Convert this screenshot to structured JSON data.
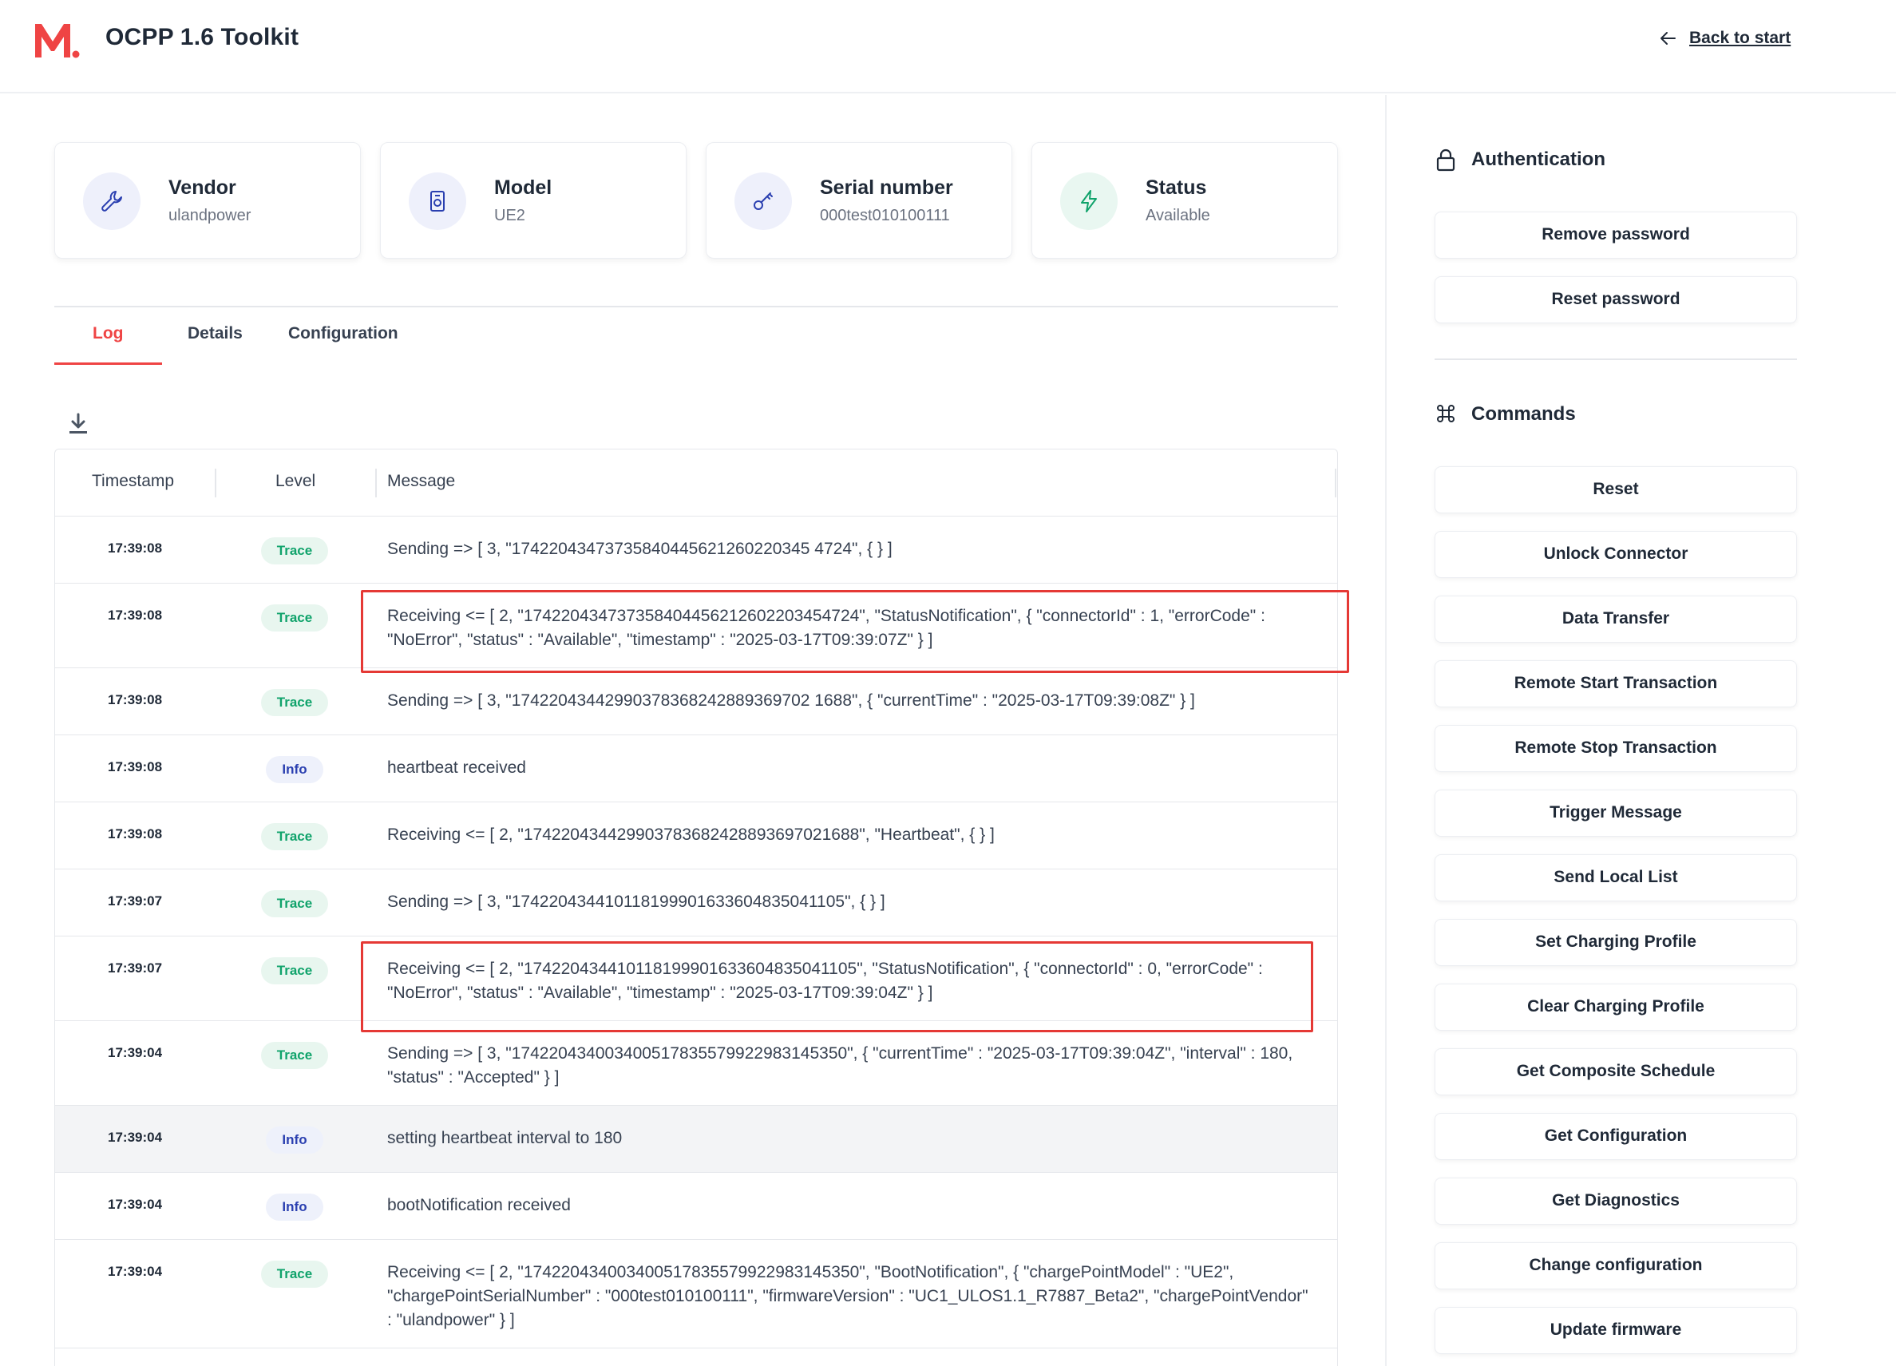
{
  "header": {
    "app_title": "OCPP 1.6 Toolkit",
    "back_label": "Back to start",
    "logo_icon": "m-logo-icon",
    "brand_color": "#ef4444"
  },
  "cards": [
    {
      "title": "Vendor",
      "value": "ulandpower",
      "icon": "wrench-icon"
    },
    {
      "title": "Model",
      "value": "UE2",
      "icon": "charger-icon"
    },
    {
      "title": "Serial number",
      "value": "000test010100111",
      "icon": "key-icon"
    },
    {
      "title": "Status",
      "value": "Available",
      "icon": "bolt-icon"
    }
  ],
  "tabs": [
    {
      "label": "Log",
      "active": true
    },
    {
      "label": "Details",
      "active": false
    },
    {
      "label": "Configuration",
      "active": false
    }
  ],
  "log_table": {
    "columns": [
      "Timestamp",
      "Level",
      "Message"
    ],
    "rows": [
      {
        "time": "17:39:08",
        "level": "Trace",
        "message": "Sending => [ 3, \"17422043473735840445621260220345 4724\", { } ]"
      },
      {
        "time": "17:39:08",
        "level": "Trace",
        "message": "Receiving <= [ 2, \"174220434737358404456212602203454724\", \"StatusNotification\", { \"connectorId\" : 1, \"errorCode\" : \"NoError\", \"status\" : \"Available\", \"timestamp\" : \"2025-03-17T09:39:07Z\" } ]"
      },
      {
        "time": "17:39:08",
        "level": "Trace",
        "message": "Sending => [ 3, \"17422043442990378368242889369702 1688\", { \"currentTime\" : \"2025-03-17T09:39:08Z\" } ]"
      },
      {
        "time": "17:39:08",
        "level": "Info",
        "message": "heartbeat received"
      },
      {
        "time": "17:39:08",
        "level": "Trace",
        "message": "Receiving <= [ 2, \"174220434429903783682428893697021688\", \"Heartbeat\", { } ]"
      },
      {
        "time": "17:39:07",
        "level": "Trace",
        "message": "Sending => [ 3, \"174220434410118199901633604835041105\", { } ]"
      },
      {
        "time": "17:39:07",
        "level": "Trace",
        "message": "Receiving <= [ 2, \"174220434410118199901633604835041105\", \"StatusNotification\", { \"connectorId\" : 0, \"errorCode\" : \"NoError\", \"status\" : \"Available\", \"timestamp\" : \"2025-03-17T09:39:04Z\" } ]"
      },
      {
        "time": "17:39:04",
        "level": "Trace",
        "message": "Sending => [ 3, \"174220434003400517835579922983145350\", { \"currentTime\" : \"2025-03-17T09:39:04Z\", \"interval\" : 180, \"status\" : \"Accepted\" } ]"
      },
      {
        "time": "17:39:04",
        "level": "Info",
        "message": "setting heartbeat interval to 180"
      },
      {
        "time": "17:39:04",
        "level": "Info",
        "message": "bootNotification received"
      },
      {
        "time": "17:39:04",
        "level": "Trace",
        "message": "Receiving <= [ 2, \"174220434003400517835579922983145350\", \"BootNotification\", { \"chargePointModel\" : \"UE2\", \"chargePointSerialNumber\" : \"000test010100111\", \"firmwareVersion\" : \"UC1_ULOS1.1_R7887_Beta2\", \"chargePointVendor\" : \"ulandpower\" } ]"
      }
    ]
  },
  "sidebar": {
    "auth_heading": "Authentication",
    "auth_buttons": [
      "Remove password",
      "Reset password"
    ],
    "commands_heading": "Commands",
    "command_buttons": [
      "Reset",
      "Unlock Connector",
      "Data Transfer",
      "Remote Start Transaction",
      "Remote Stop Transaction",
      "Trigger Message",
      "Send Local List",
      "Set Charging Profile",
      "Clear Charging Profile",
      "Get Composite Schedule",
      "Get Configuration",
      "Get Diagnostics",
      "Change configuration",
      "Update firmware"
    ]
  }
}
